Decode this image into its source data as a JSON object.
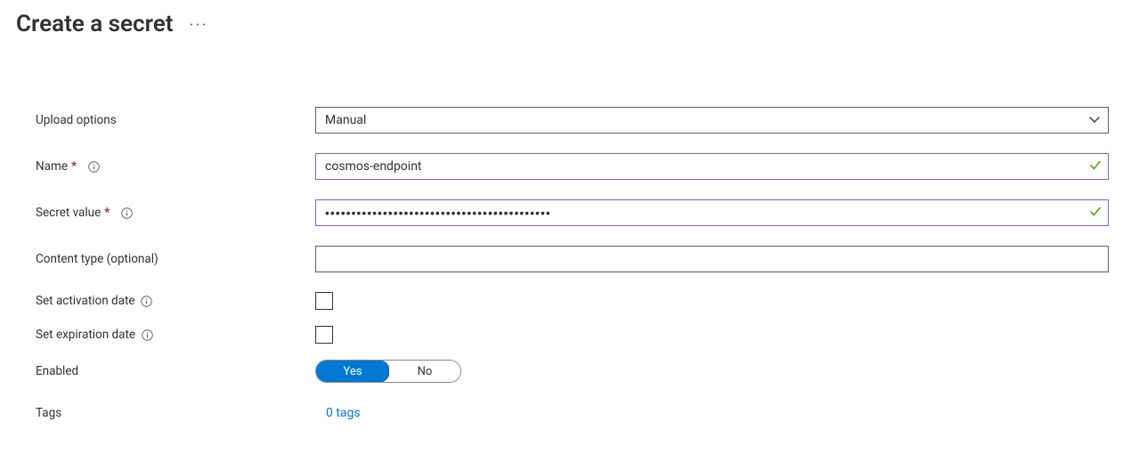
{
  "header": {
    "title": "Create a secret"
  },
  "form": {
    "upload_options": {
      "label": "Upload options",
      "value": "Manual"
    },
    "name": {
      "label": "Name",
      "value": "cosmos-endpoint",
      "valid": true
    },
    "secret_value": {
      "label": "Secret value",
      "masked": "•••••••••••••••••••••••••••••••••••••••••••",
      "valid": true
    },
    "content_type": {
      "label": "Content type (optional)",
      "value": ""
    },
    "activation": {
      "label": "Set activation date",
      "checked": false
    },
    "expiration": {
      "label": "Set expiration date",
      "checked": false
    },
    "enabled": {
      "label": "Enabled",
      "yes": "Yes",
      "no": "No",
      "value": "Yes"
    },
    "tags": {
      "label": "Tags",
      "link": "0 tags"
    }
  }
}
